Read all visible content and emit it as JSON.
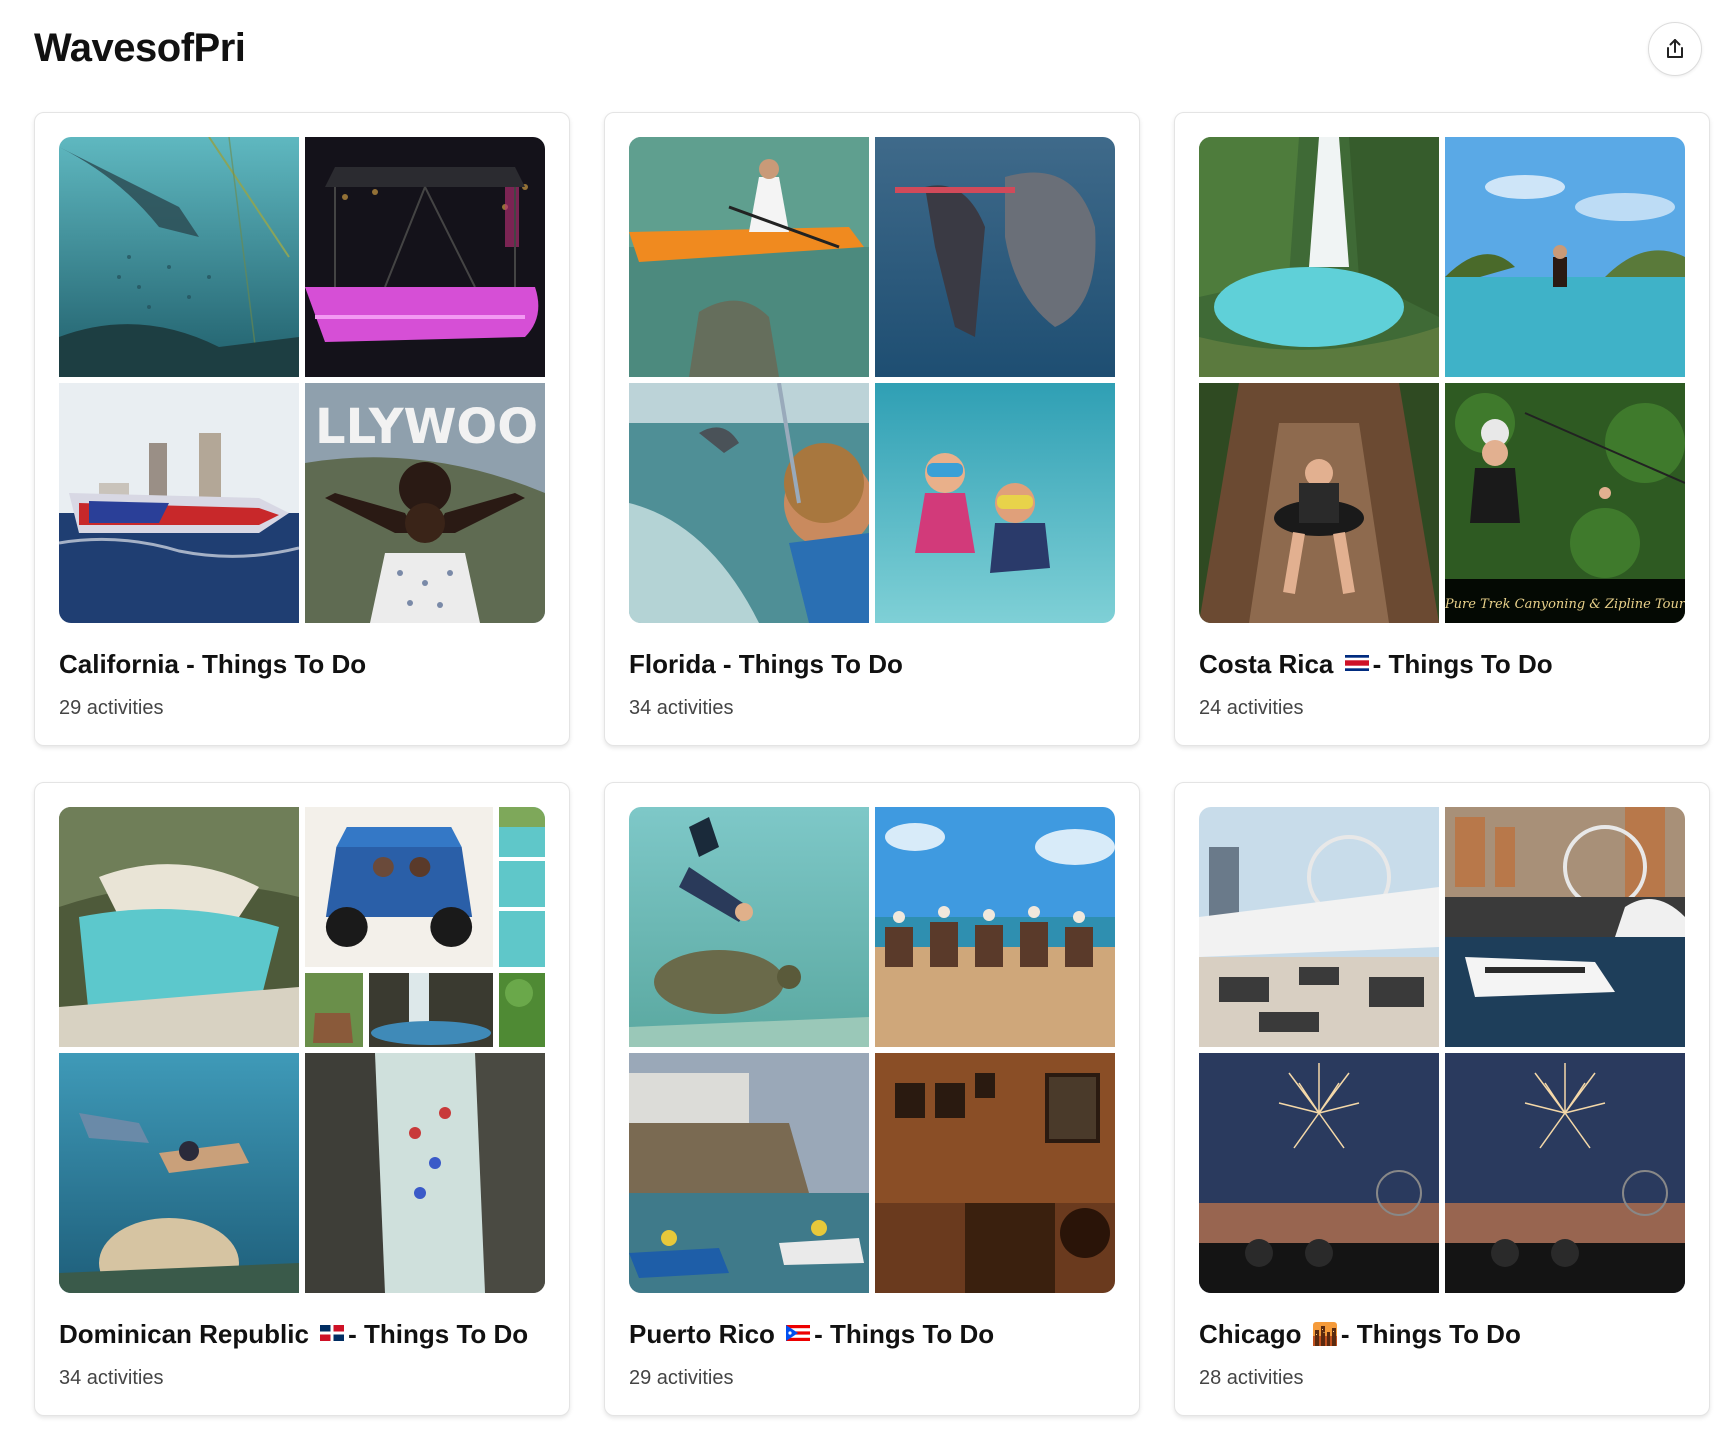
{
  "header": {
    "title": "WavesofPri",
    "share_icon": "share-icon"
  },
  "cards": [
    {
      "title_pre": "California - Things To Do",
      "title_post": "",
      "flag": "",
      "count": "29 activities",
      "images": [
        "snorkeling-kelp-photo",
        "glowing-pink-boat-night-photo",
        "patriot-speedboat-photo",
        "hollywood-sign-woman-photo"
      ],
      "image_caption": ""
    },
    {
      "title_pre": "Florida - Things To Do",
      "title_post": "",
      "flag": "",
      "count": "34 activities",
      "images": [
        "kayak-manatee-photo",
        "manatee-underwater-photo",
        "boy-watching-dolphin-photo",
        "kids-snorkeling-photo"
      ],
      "image_caption": ""
    },
    {
      "title_pre": "Costa Rica",
      "title_post": "- Things To Do",
      "flag": "costa-rica-flag",
      "count": "24 activities",
      "images": [
        "turquoise-waterfall-photo",
        "infinity-pool-photo",
        "water-slide-tube-photo",
        "zipline-woman-photo"
      ],
      "image_caption": "Pure Trek Canyoning & Zipline Tour"
    },
    {
      "title_pre": "Dominican Republic",
      "title_post": "- Things To Do",
      "flag": "dominican-republic-flag",
      "count": "34 activities",
      "images": [
        "cave-lagoon-photo",
        "activity-collage-photo",
        "snorkeling-coral-photo",
        "river-tubing-canyon-photo"
      ],
      "image_caption": ""
    },
    {
      "title_pre": "Puerto Rico",
      "title_post": "- Things To Do",
      "flag": "puerto-rico-flag",
      "count": "29 activities",
      "images": [
        "sea-turtle-snorkel-photo",
        "beach-horseback-photo",
        "jet-ski-fort-photo",
        "museum-interior-photo"
      ],
      "image_caption": ""
    },
    {
      "title_pre": "Chicago",
      "title_post": "- Things To Do",
      "flag": "cityscape-emoji",
      "count": "28 activities",
      "images": [
        "yacht-deck-ferris-wheel-photo",
        "navy-pier-cruise-photo",
        "fireworks-skyline-photo",
        "fireworks-skyline-photo-2"
      ],
      "image_caption": ""
    }
  ]
}
